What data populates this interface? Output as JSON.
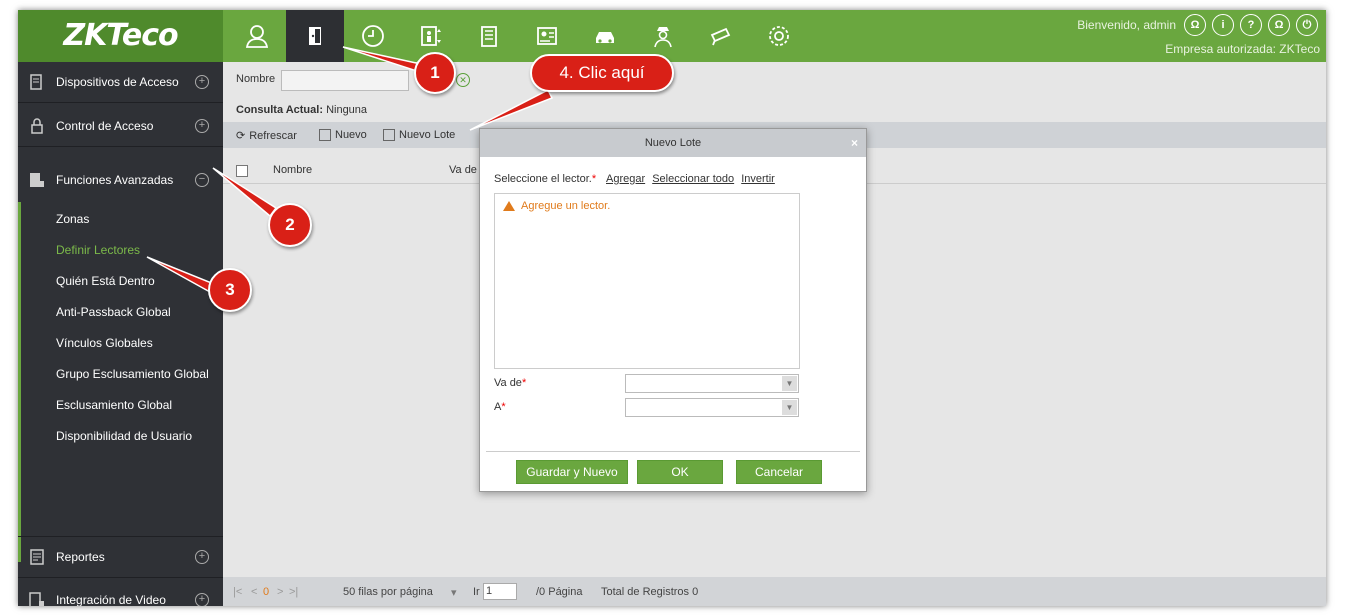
{
  "header": {
    "logo": "ZKTeco",
    "welcome": "Bienvenido, admin",
    "empresa": "Empresa autorizada: ZKTeco",
    "nav_icons": [
      "person-icon",
      "door-icon",
      "clock-icon",
      "elevator-icon",
      "building-icon",
      "visitor-icon",
      "car-icon",
      "guard-icon",
      "camera-icon",
      "gear-icon"
    ]
  },
  "sidebar": {
    "sections": {
      "dispositivos": "Dispositivos de Acceso",
      "control": "Control de Acceso",
      "funciones": "Funciones Avanzadas",
      "reportes": "Reportes",
      "video": "Integración de Video"
    },
    "items": [
      "Zonas",
      "Definir Lectores",
      "Quién Está Dentro",
      "Anti-Passback Global",
      "Vínculos Globales",
      "Grupo Esclusamiento Global",
      "Esclusamiento Global",
      "Disponibilidad de Usuario"
    ],
    "active_index": 1
  },
  "filter": {
    "nombre_label": "Nombre",
    "nombre_value": ""
  },
  "consulta": {
    "label": "Consulta Actual:",
    "value": "Ninguna"
  },
  "toolbar": {
    "refrescar": "Refrescar",
    "nuevo": "Nuevo",
    "nuevo_lote": "Nuevo Lote"
  },
  "table": {
    "col_nombre": "Nombre",
    "col_va_de": "Va de"
  },
  "pager": {
    "first": "|<",
    "prev": "<",
    "page": "0",
    "next": ">",
    "last": ">|",
    "rows_per_page": "50 filas por página",
    "goto_label": "Ir a",
    "goto_value": "1",
    "pages": "/0 Página",
    "total": "Total de Registros 0"
  },
  "dialog": {
    "title": "Nuevo Lote",
    "close": "×",
    "select_label": "Seleccione el lector.",
    "req": "*",
    "link_add": "Agregar",
    "link_all": "Seleccionar todo",
    "link_invert": "Invertir",
    "warning": "Agregue un lector.",
    "va_de_label": "Va de",
    "a_label": "A",
    "btn_save_new": "Guardar y Nuevo",
    "btn_ok": "OK",
    "btn_cancel": "Cancelar"
  },
  "callouts": {
    "c1": "1",
    "c2": "2",
    "c3": "3",
    "c4": "4. Clic aquí"
  },
  "colors": {
    "brand_green": "#6aa73f",
    "sidebar_dark": "#2f3136",
    "callout_red": "#d92017",
    "warning_orange": "#e07b1c"
  }
}
